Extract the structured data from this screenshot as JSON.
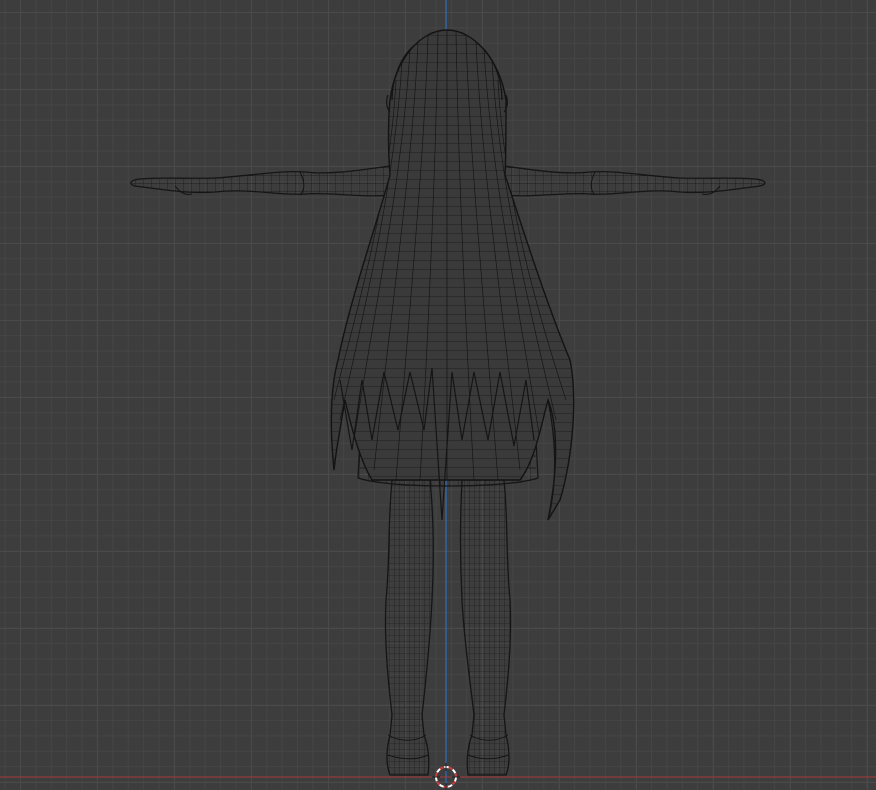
{
  "viewport": {
    "mode": "wireframe",
    "view": "front-orthographic",
    "grid_color": "#4a4a4a",
    "background_color": "#3d3d3d",
    "axis_z_color": "#2f6ec0",
    "axis_x_color": "#a83a3a",
    "wire_color": "#141414"
  },
  "model": {
    "icon": "character-mesh-icon",
    "pose": "t-pose"
  },
  "cursor": {
    "icon": "3d-cursor-icon"
  }
}
